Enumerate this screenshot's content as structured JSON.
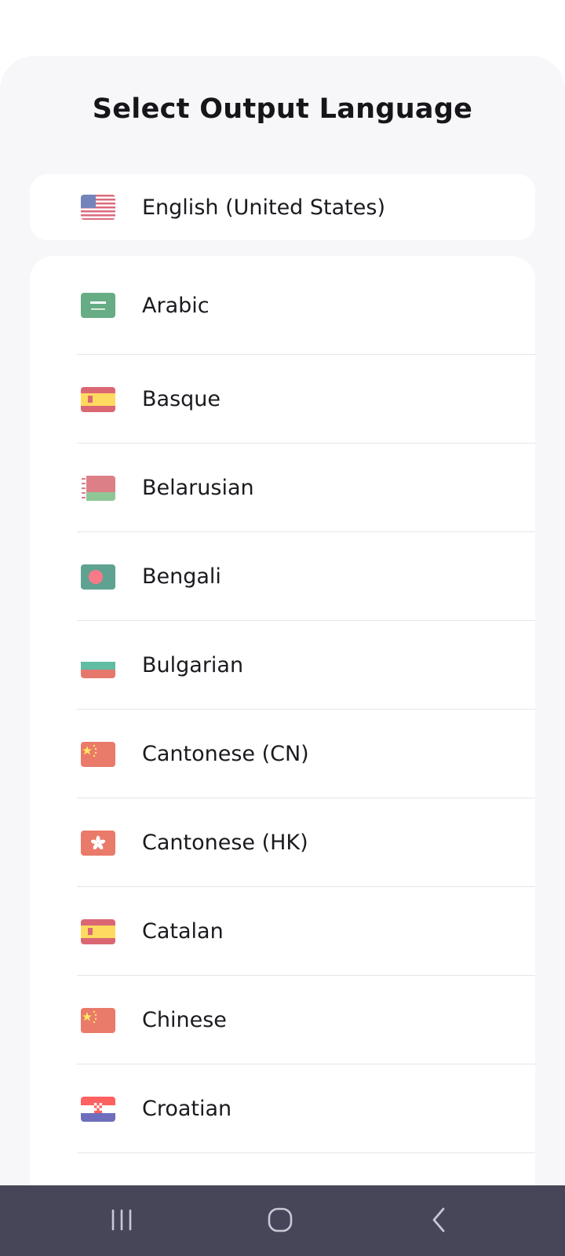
{
  "title": "Select Output Language",
  "selected": {
    "label": "English (United States)",
    "flag_icon": "us-flag-icon"
  },
  "languages": [
    {
      "label": "Arabic",
      "flag_icon": "saudi-flag-icon"
    },
    {
      "label": "Basque",
      "flag_icon": "spain-flag-icon"
    },
    {
      "label": "Belarusian",
      "flag_icon": "belarus-flag-icon"
    },
    {
      "label": "Bengali",
      "flag_icon": "bangladesh-flag-icon"
    },
    {
      "label": "Bulgarian",
      "flag_icon": "bulgaria-flag-icon"
    },
    {
      "label": "Cantonese (CN)",
      "flag_icon": "china-flag-icon"
    },
    {
      "label": "Cantonese (HK)",
      "flag_icon": "hong-kong-flag-icon"
    },
    {
      "label": "Catalan",
      "flag_icon": "spain-flag-icon"
    },
    {
      "label": "Chinese",
      "flag_icon": "china-flag-icon"
    },
    {
      "label": "Croatian",
      "flag_icon": "croatia-flag-icon"
    }
  ],
  "nav": {
    "recents_icon": "recents-icon",
    "home_icon": "home-icon",
    "back_icon": "back-icon"
  },
  "colors": {
    "sheet_bg": "#f7f6f9",
    "card_bg": "#ffffff",
    "navbar_bg": "#474659",
    "divider": "#e6e5ea"
  }
}
